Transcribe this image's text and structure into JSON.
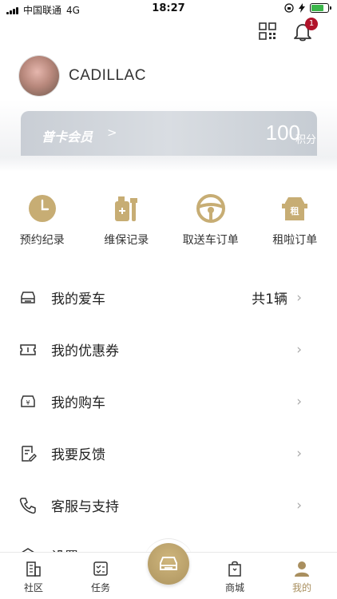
{
  "status": {
    "carrier": "中国联通",
    "network": "4G",
    "time": "18:27"
  },
  "header": {
    "notification_count": "1"
  },
  "profile": {
    "name": "CADILLAC"
  },
  "member_card": {
    "title": "普卡会员",
    "chevron": ">",
    "points": "100",
    "points_unit": "积分"
  },
  "quick_actions": [
    {
      "label": "预约纪录",
      "icon": "clock-icon"
    },
    {
      "label": "维保记录",
      "icon": "maintenance-icon"
    },
    {
      "label": "取送车订单",
      "icon": "steering-wheel-icon"
    },
    {
      "label": "租啦订单",
      "icon": "rent-icon"
    }
  ],
  "menu": [
    {
      "label": "我的爱车",
      "extra": "共1辆",
      "icon": "car-icon"
    },
    {
      "label": "我的优惠券",
      "extra": "",
      "icon": "coupon-icon"
    },
    {
      "label": "我的购车",
      "extra": "",
      "icon": "car-purchase-icon"
    },
    {
      "label": "我要反馈",
      "extra": "",
      "icon": "feedback-icon"
    },
    {
      "label": "客服与支持",
      "extra": "",
      "icon": "phone-icon"
    },
    {
      "label": "设置",
      "extra": "",
      "icon": "settings-icon"
    }
  ],
  "tabbar": {
    "community": "社区",
    "tasks": "任务",
    "mall": "商城",
    "mine": "我的"
  },
  "colors": {
    "accent": "#a98f5f",
    "badge": "#b1132a",
    "card": "#c9ced5"
  }
}
